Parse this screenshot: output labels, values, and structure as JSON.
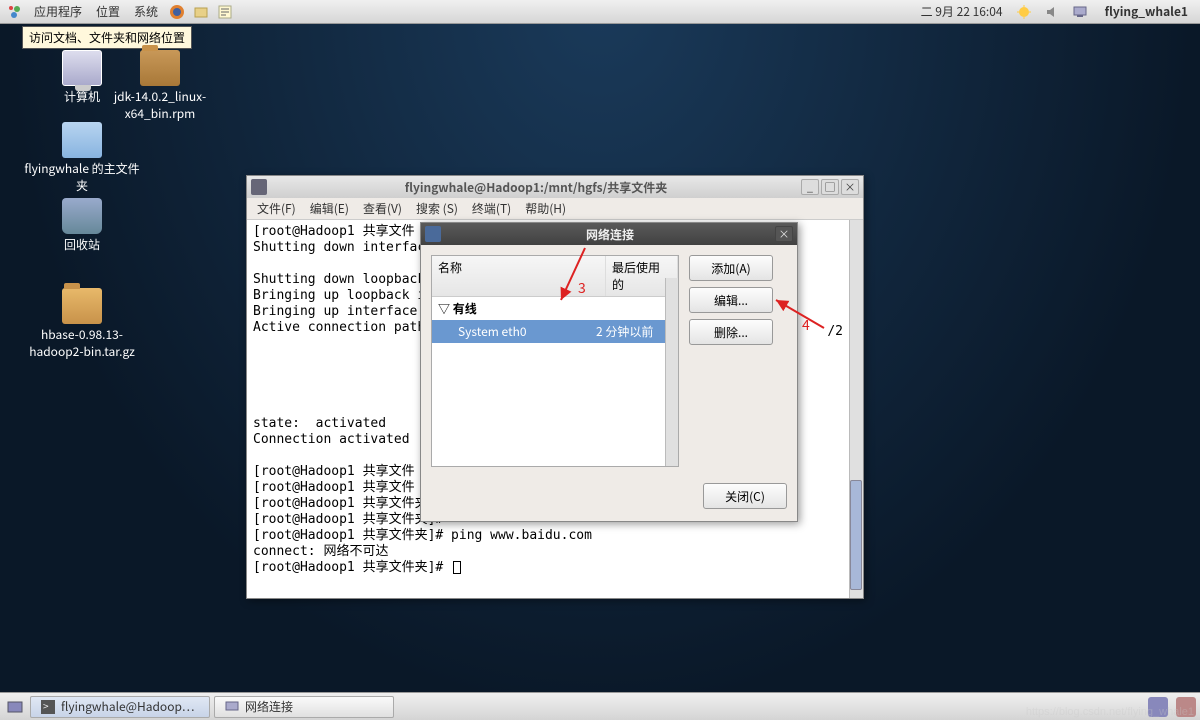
{
  "panel": {
    "menu_apps": "应用程序",
    "menu_places": "位置",
    "menu_system": "系统",
    "clock": "二 9月 22 16:04",
    "user": "flying_whale1",
    "tooltip": "访问文档、文件夹和网络位置"
  },
  "desktop": {
    "computer": "计算机",
    "jdk": "jdk-14.0.2_linux-x64_bin.rpm",
    "home": "flyingwhale 的主文件夹",
    "trash": "回收站",
    "hbase": "hbase-0.98.13-hadoop2-bin.tar.gz"
  },
  "terminal": {
    "title": "flyingwhale@Hadoop1:/mnt/hgfs/共享文件夹",
    "menu": {
      "file": "文件(F)",
      "edit": "编辑(E)",
      "view": "查看(V)",
      "search": "搜索 (S)",
      "terminal": "终端(T)",
      "help": "帮助(H)"
    },
    "lines": [
      "[root@Hadoop1 共享文件",
      "Shutting down interfac",
      "",
      "Shutting down loopback",
      "Bringing up loopback i",
      "Bringing up interface ",
      "Active connection path",
      "",
      "",
      "",
      "",
      "",
      "state:  activated",
      "Connection activated",
      "",
      "[root@Hadoop1 共享文件",
      "[root@Hadoop1 共享文件",
      "[root@Hadoop1 共享文件夹]#",
      "[root@Hadoop1 共享文件夹]#",
      "[root@Hadoop1 共享文件夹]# ping www.baidu.com",
      "connect: 网络不可达",
      "[root@Hadoop1 共享文件夹]# "
    ],
    "frag_right": "/2"
  },
  "dialog": {
    "title": "网络连接",
    "col_name": "名称",
    "col_last": "最后使用的",
    "group": "有线",
    "item_name": "System eth0",
    "item_time": "2 分钟以前",
    "btn_add": "添加(A)",
    "btn_edit": "编辑...",
    "btn_del": "删除...",
    "btn_close": "关闭(C)"
  },
  "annot": {
    "a3": "3",
    "a4": "4"
  },
  "taskbar": {
    "t1": "flyingwhale@Hadoop…",
    "t2": "网络连接"
  },
  "watermark": "https://blog.csdn.net/flying_whale1"
}
